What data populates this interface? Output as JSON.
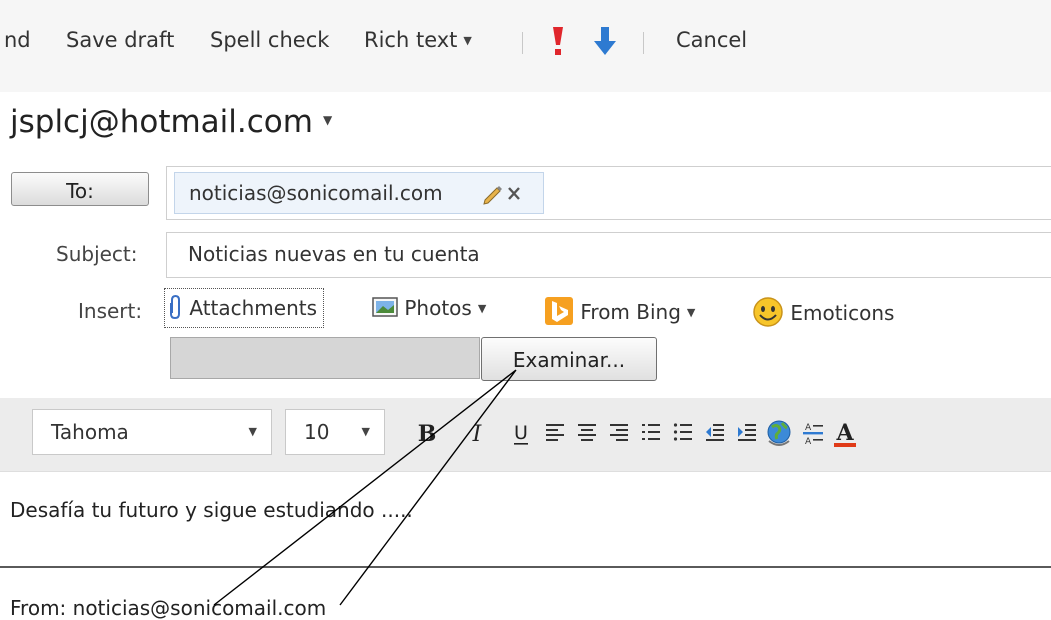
{
  "toolbar": {
    "send_label": "nd",
    "save_draft_label": "Save draft",
    "spell_check_label": "Spell check",
    "rich_text_label": "Rich text",
    "cancel_label": "Cancel",
    "high_priority_color": "#e0262c",
    "low_priority_color": "#2e7ad1"
  },
  "from": {
    "account": "jsplcj@hotmail.com"
  },
  "to": {
    "button_label": "To:",
    "recipients": [
      "noticias@sonicomail.com"
    ]
  },
  "subject": {
    "label": "Subject:",
    "value": "Noticias nuevas en tu cuenta"
  },
  "insert": {
    "label": "Insert:",
    "items": [
      "Attachments",
      "Photos",
      "From Bing",
      "Emoticons"
    ]
  },
  "file_input": {
    "button_label": "Examinar..."
  },
  "format": {
    "font": "Tahoma",
    "size": "10",
    "buttons": [
      "bold-icon",
      "italic-icon",
      "underline-icon",
      "align-left-icon",
      "align-center-icon",
      "align-right-icon",
      "numbered-list-icon",
      "bulleted-list-icon",
      "decrease-indent-icon",
      "increase-indent-icon",
      "insert-link-icon",
      "highlight-icon",
      "font-color-icon"
    ],
    "font_color": "#e03a17"
  },
  "body": {
    "text": "Desafía tu futuro y sigue estudiando .....",
    "forwarded_from": "From: noticias@sonicomail.com"
  }
}
